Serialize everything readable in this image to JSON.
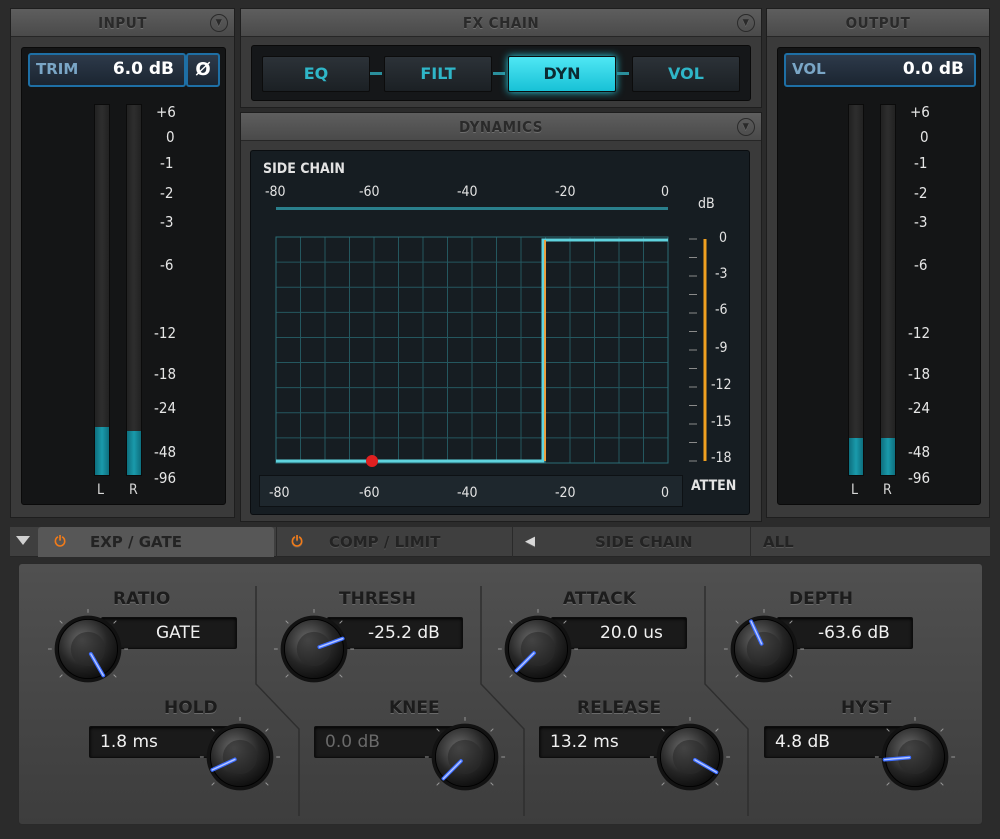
{
  "input": {
    "title": "INPUT",
    "trim_label": "TRIM",
    "trim_value": "6.0 dB",
    "phase_symbol": "Ø",
    "scale": [
      "+6",
      "0",
      "-1",
      "-2",
      "-3",
      "-6",
      "-12",
      "-18",
      "-24",
      "-48",
      "-96"
    ],
    "channels": [
      "L",
      "R"
    ],
    "levels": [
      0.13,
      0.12
    ]
  },
  "fx_chain": {
    "title": "FX CHAIN",
    "buttons": [
      "EQ",
      "FILT",
      "DYN",
      "VOL"
    ],
    "active": "DYN"
  },
  "dynamics": {
    "title": "DYNAMICS",
    "side_chain_label": "SIDE CHAIN",
    "top_scale": [
      "-80",
      "-60",
      "-40",
      "-20",
      "0"
    ],
    "db_label": "dB",
    "atten_scale": [
      "0",
      "-3",
      "-6",
      "-9",
      "-12",
      "-15",
      "-18"
    ],
    "atten_label": "ATTEN",
    "bottom_scale": [
      "-80",
      "-60",
      "-40",
      "-20",
      "0"
    ]
  },
  "output": {
    "title": "OUTPUT",
    "vol_label": "VOL",
    "vol_value": "0.0 dB",
    "scale": [
      "+6",
      "0",
      "-1",
      "-2",
      "-3",
      "-6",
      "-12",
      "-18",
      "-24",
      "-48",
      "-96"
    ],
    "channels": [
      "L",
      "R"
    ],
    "levels": [
      0.1,
      0.1
    ]
  },
  "tabs": {
    "exp_gate": "EXP / GATE",
    "comp_limit": "COMP / LIMIT",
    "side_chain": "SIDE CHAIN",
    "all": "ALL"
  },
  "controls": {
    "ratio": {
      "label": "RATIO",
      "value": "GATE"
    },
    "thresh": {
      "label": "THRESH",
      "value": "-25.2 dB"
    },
    "attack": {
      "label": "ATTACK",
      "value": "20.0 us"
    },
    "depth": {
      "label": "DEPTH",
      "value": "-63.6 dB"
    },
    "hold": {
      "label": "HOLD",
      "value": "1.8 ms"
    },
    "knee": {
      "label": "KNEE",
      "value": "0.0 dB"
    },
    "release": {
      "label": "RELEASE",
      "value": "13.2 ms"
    },
    "hyst": {
      "label": "HYST",
      "value": "4.8 dB"
    }
  },
  "colors": {
    "accent_cyan": "#2ad4e6",
    "meter_teal": "#1a9aab",
    "atten_orange": "#f0a020",
    "knob_indicator": "#3b6cff",
    "power_orange": "#f07b1a",
    "marker_red": "#e02020"
  }
}
